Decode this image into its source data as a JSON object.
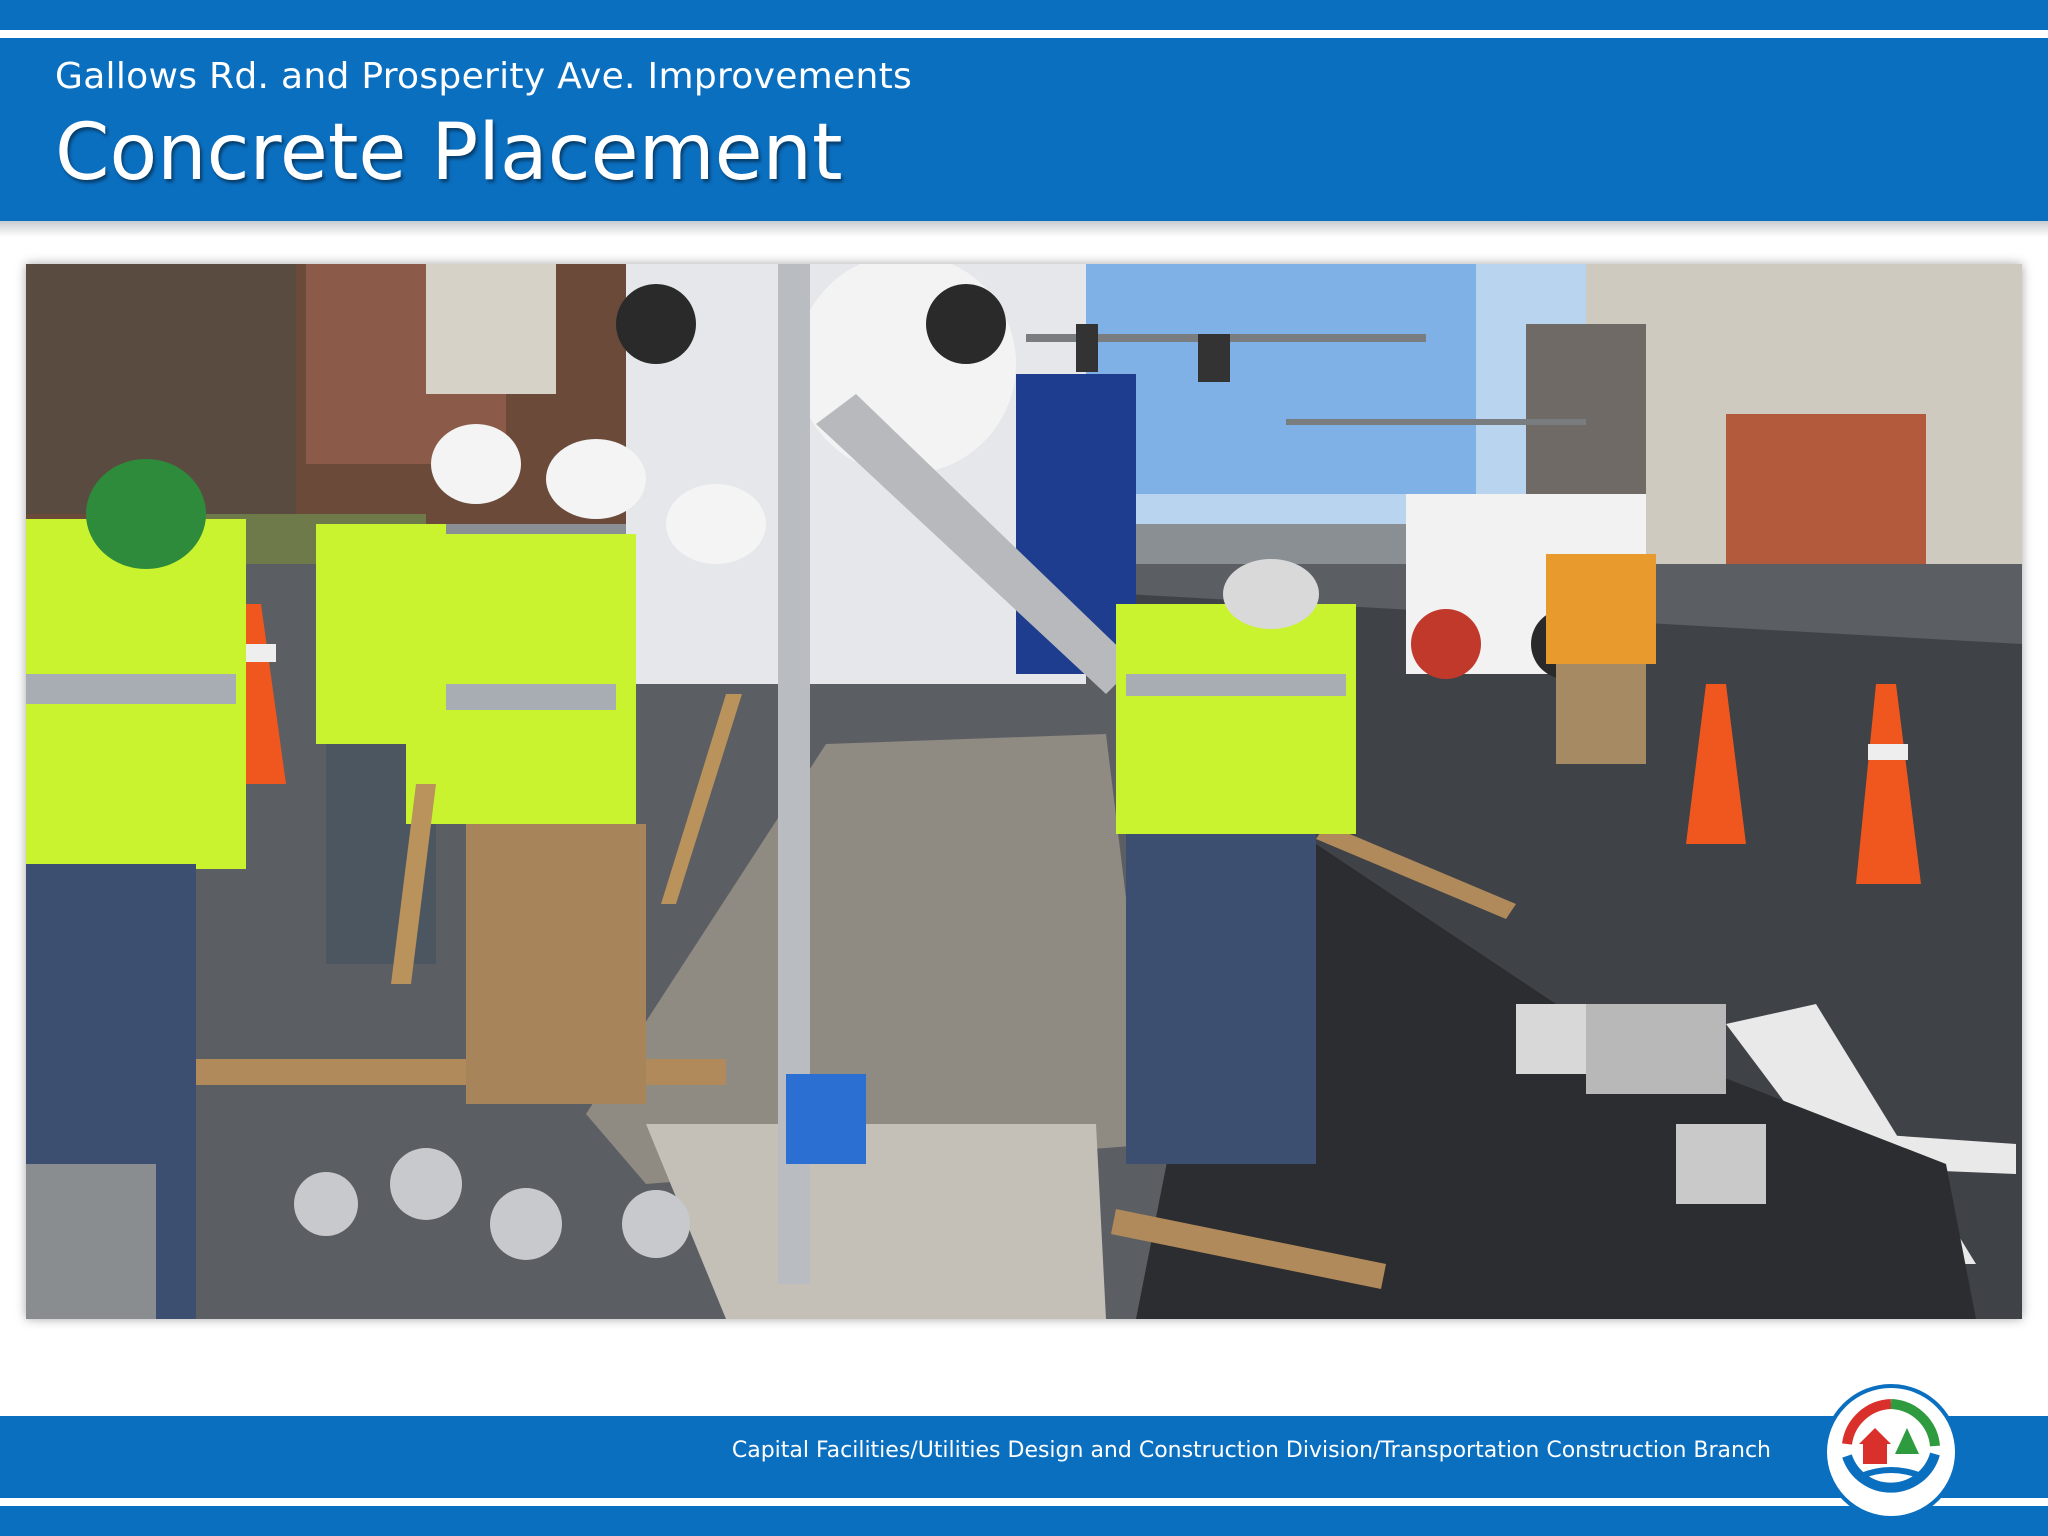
{
  "header": {
    "subtitle": "Gallows Rd. and Prosperity Ave. Improvements",
    "title": "Concrete Placement"
  },
  "photo": {
    "description_icon": "construction-photo"
  },
  "footer": {
    "text": "Capital Facilities/Utilities Design and Construction Division/Transportation Construction Branch"
  },
  "colors": {
    "brand_blue": "#0b6fc0",
    "vest_yellow": "#c9f22f",
    "cone_orange": "#f0571e"
  },
  "logo": {
    "icon": "county-seal-icon"
  }
}
